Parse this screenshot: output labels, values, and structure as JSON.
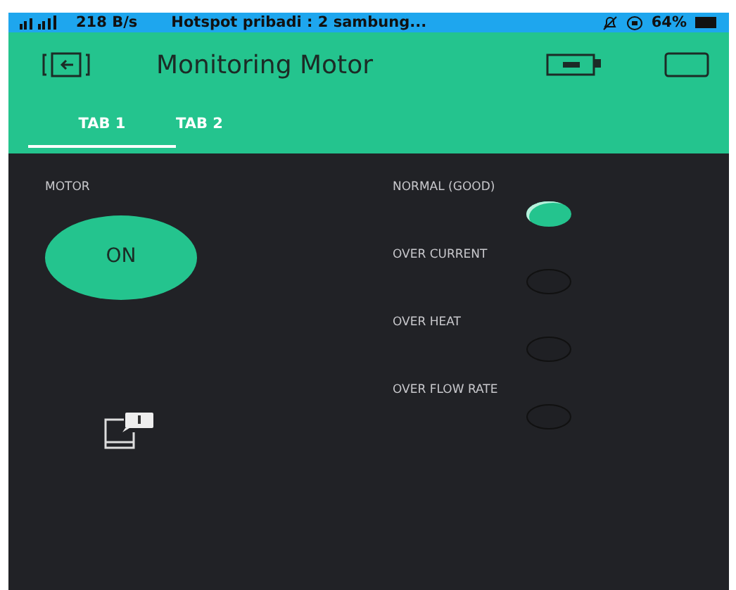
{
  "status_bar": {
    "speed": "218 B/s",
    "hotspot": "Hotspot pribadi : 2 sambung...",
    "battery": "64%"
  },
  "header": {
    "title": "Monitoring Motor"
  },
  "tabs": [
    {
      "label": "TAB 1",
      "selected": true
    },
    {
      "label": "TAB 2",
      "selected": false
    }
  ],
  "motor": {
    "label": "MOTOR",
    "button": "ON",
    "on": true
  },
  "leds": [
    {
      "label": "NORMAL (GOOD)",
      "on": true
    },
    {
      "label": "OVER CURRENT",
      "on": false
    },
    {
      "label": "OVER HEAT",
      "on": false
    },
    {
      "label": "OVER FLOW RATE",
      "on": false
    }
  ]
}
